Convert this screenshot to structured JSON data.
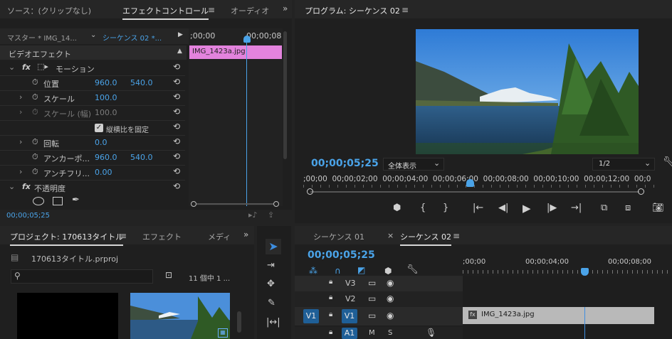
{
  "source_panel": {
    "tab_source": "ソース：(クリップなし)",
    "tab_effect_controls": "エフェクトコントロール",
    "tab_audio": "オーディオ",
    "master_label": "マスター * IMG_14...",
    "sequence_label": "シーケンス 02 *...",
    "ruler_start": ";00;00",
    "ruler_end": "00;00;08",
    "clip_name": "IMG_1423a.jpg",
    "video_effects_header": "ビデオエフェクト",
    "motion_label": "モーション",
    "position_label": "位置",
    "position_x": "960.0",
    "position_y": "540.0",
    "scale_label": "スケール",
    "scale_value": "100.0",
    "scale_width_label": "スケール (幅)",
    "scale_width_value": "100.0",
    "uniform_scale_label": "縦横比を固定",
    "rotation_label": "回転",
    "rotation_value": "0.0",
    "anchor_label": "アンカーポ...",
    "anchor_x": "960.0",
    "anchor_y": "540.0",
    "antiflicker_label": "アンチフリ...",
    "antiflicker_value": "0.00",
    "opacity_label": "不透明度",
    "timecode": "00;00;05;25"
  },
  "program_monitor": {
    "title": "プログラム: シーケンス 02",
    "timecode": "00;00;05;25",
    "fit_label": "全体表示",
    "resolution": "1/2",
    "ruler_text": ";00;00  00;00;02;00  00;00;04;00  00;00;06;00  00;00;08;00  00;00;10;00  00;00;12;00  00;0"
  },
  "project_panel": {
    "tab_project": "プロジェクト: 170613タイトル",
    "tab_effects": "エフェクト",
    "tab_media": "メディ",
    "file_name": "170613タイトル.prproj",
    "item_count": "11 個中 1 ...",
    "search_placeholder": ""
  },
  "timeline": {
    "tab_seq01": "シーケンス 01",
    "tab_seq02": "シーケンス 02",
    "timecode": "00;00;05;25",
    "ruler_0": ";00;00",
    "ruler_4": "00;00;04;00",
    "ruler_8": "00;00;08;00",
    "track_v3": "V3",
    "track_v2": "V2",
    "track_v1": "V1",
    "source_v1": "V1",
    "track_a1": "A1",
    "mute": "M",
    "solo": "S",
    "clip_name": "IMG_1423a.jpg",
    "clip_fx": "fx"
  },
  "colors": {
    "accent_blue": "#4aa3e8",
    "clip_pink": "#e383dd",
    "timeline_clip": "#b9b9b9",
    "playhead": "#3f8fe0"
  }
}
